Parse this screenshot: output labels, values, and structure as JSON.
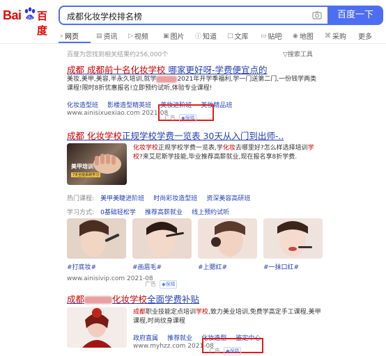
{
  "header": {
    "logo_bai": "Bai",
    "logo_du": "百度",
    "query": "成都化妆学校排名榜",
    "search_button": "百度一下"
  },
  "tabs": [
    {
      "label": "网页",
      "icon": "search-icon"
    },
    {
      "label": "资讯",
      "icon": "news-icon"
    },
    {
      "label": "视频",
      "icon": "video-icon"
    },
    {
      "label": "图片",
      "icon": "image-icon"
    },
    {
      "label": "知道",
      "icon": "question-icon"
    },
    {
      "label": "文库",
      "icon": "document-icon"
    },
    {
      "label": "贴吧",
      "icon": "chat-icon"
    },
    {
      "label": "地图",
      "icon": "map-icon"
    },
    {
      "label": "采购",
      "icon": "cart-icon"
    },
    {
      "label": "更多",
      "icon": ""
    }
  ],
  "result_count": "百度为您找到相关结果约256,000个",
  "tools": "搜索工具",
  "r1": {
    "title_a": "成都",
    "title_b": " 成都前十名",
    "title_c": "化妆学校",
    "title_d": " 哪家更好呀-学费便宜点的",
    "desc_a": "美妆,美甲,美容,半永久培训,就学",
    "desc_b": "2021年开学季福利,学一门送第二门,一份钱学两类课程!限时8折优惠报名!立即预约试听,体验专业课程!",
    "links": [
      "化妆造型班",
      "影楼造型精英班",
      "美妆进阶班",
      "美妆精品班"
    ],
    "url": "www.ainisixuexiao.com 2021-08",
    "ad": "广告",
    "badge": "保障"
  },
  "r2": {
    "title_a": "成都",
    "title_b": " 化妆学校",
    "title_c": "正规学校学费一览表 30天从入门到出师-..",
    "thumb_text1": "美甲培训",
    "thumb_text2": "7天全能系统学习",
    "desc_a": "化妆学校",
    "desc_b": "正规学校学费一览表,学",
    "desc_c": "化妆",
    "desc_d": "去哪里好?怎么样选择培训",
    "desc_e": "学校",
    "desc_f": "?来艾尼斯学技能,毕业推荐高薪就业,现在报名享8折学费.",
    "hot_label": "热门课程:",
    "hot_links": [
      "美甲美睫进阶班",
      "时尚彩妆造型班",
      "资深美容高研班"
    ],
    "way_label": "学习方式:",
    "way_links": [
      "0基础轻松学",
      "推荐高薪就业",
      "线上预约试听"
    ],
    "images": [
      "#打底妆#",
      "#画眉毛#",
      "#上腮红#",
      "#一抹口红#"
    ],
    "url": "www.ainisivip.com 2021-08",
    "ad": "广告",
    "badge": "保障"
  },
  "r3": {
    "title_a": "成都",
    "title_b": "化妆学校",
    "title_c": "全面学费补贴",
    "desc_a": "成都",
    "desc_b": "职业技能定点培训",
    "desc_c": "学校",
    "desc_d": ",致力美业培训,免费学高定手工课程,美甲课程,时尚纹身课程",
    "links": [
      "政府直属",
      "推荐就业",
      "化妆造型",
      "鉴定中心"
    ],
    "url": "www.myhzz.com 2021-08",
    "ad": "广告",
    "badge": "保障"
  }
}
